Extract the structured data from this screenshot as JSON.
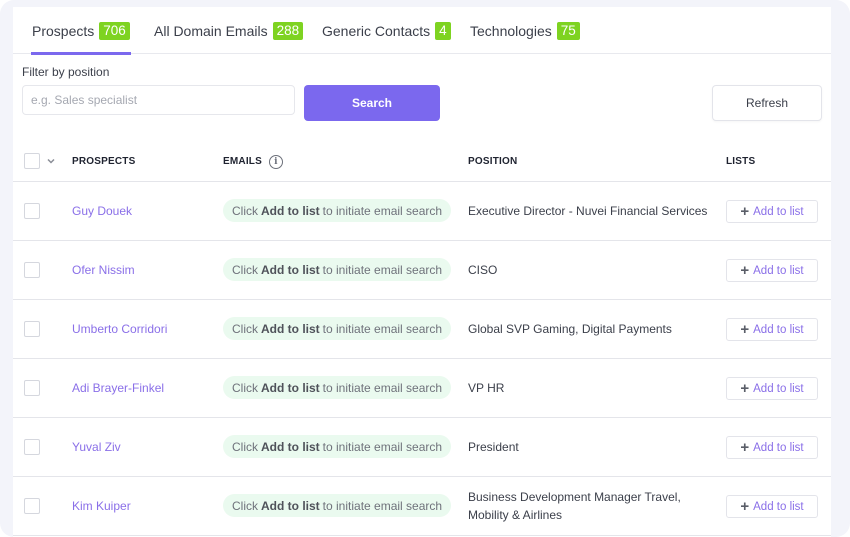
{
  "tabs": [
    {
      "label": "Prospects",
      "count": "706",
      "active": true
    },
    {
      "label": "All Domain Emails",
      "count": "288",
      "active": false
    },
    {
      "label": "Generic Contacts",
      "count": "4",
      "active": false
    },
    {
      "label": "Technologies",
      "count": "75",
      "active": false
    }
  ],
  "filter": {
    "label": "Filter by position",
    "placeholder": "e.g. Sales specialist",
    "value": "",
    "search_label": "Search",
    "refresh_label": "Refresh"
  },
  "table": {
    "columns": {
      "prospects": "PROSPECTS",
      "emails": "EMAILS",
      "position": "POSITION",
      "lists": "LISTS"
    },
    "email_hint": {
      "prefix": "Click",
      "bold": "Add to list",
      "suffix": "to initiate email search"
    },
    "add_label": "Add to list",
    "rows": [
      {
        "name": "Guy Douek",
        "position": "Executive Director - Nuvei Financial Services"
      },
      {
        "name": "Ofer Nissim",
        "position": "CISO"
      },
      {
        "name": "Umberto Corridori",
        "position": "Global SVP Gaming, Digital Payments"
      },
      {
        "name": "Adi Brayer-Finkel",
        "position": "VP HR"
      },
      {
        "name": "Yuval Ziv",
        "position": "President"
      },
      {
        "name": "Kim Kuiper",
        "position": "Business Development Manager Travel, Mobility & Airlines"
      }
    ]
  },
  "colors": {
    "accent": "#7b68ee",
    "badge": "#7ed321",
    "link": "#8a6fe8",
    "email_pill_bg": "#eafaef"
  }
}
